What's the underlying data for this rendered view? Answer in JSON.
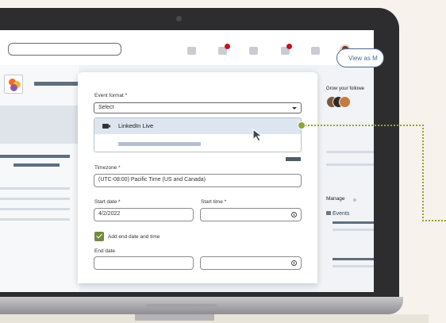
{
  "modal": {
    "event_format_label": "Event format *",
    "event_format_value": "Select",
    "dropdown_option": "LinkedIn Live",
    "timezone_label": "Timezone *",
    "timezone_value": "(UTC-08:00) Pacific Time (US and Canada)",
    "start_date_label": "Start date *",
    "start_date_value": "4/2/2022",
    "start_time_label": "Start time *",
    "add_end_label": "Add end date and time",
    "end_date_label": "End date"
  },
  "sidebar": {
    "view_as_label": "View as M",
    "grow_label": "Grow your followe",
    "manage_label": "Manage",
    "events_label": "Events"
  },
  "colors": {
    "accent_green": "#8fa334",
    "checkbox_green": "#6f8b3b",
    "notification_red": "#cc1016",
    "bezel": "#2d2d2f"
  },
  "icons": [
    "caret-down-icon",
    "video-camera-icon",
    "clock-icon",
    "checkmark-icon",
    "mouse-cursor-icon",
    "events-icon"
  ]
}
